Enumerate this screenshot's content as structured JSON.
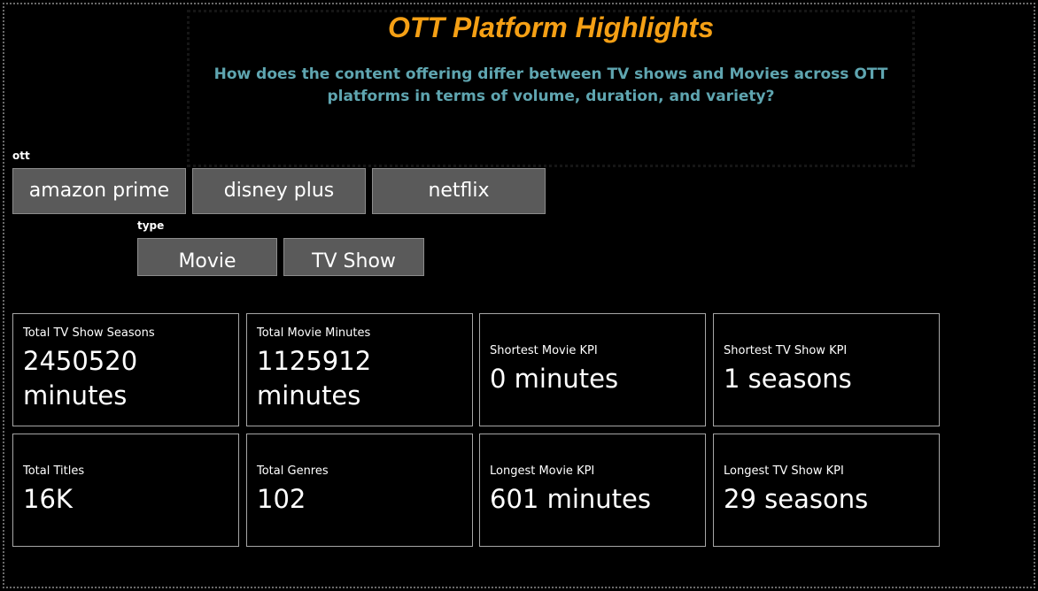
{
  "header": {
    "title": "OTT Platform Highlights",
    "subtitle": "How does the content offering differ between TV shows and Movies across OTT platforms in terms of volume, duration, and variety?"
  },
  "slicers": {
    "ott": {
      "label": "ott",
      "options": [
        "amazon prime",
        "disney plus",
        "netflix"
      ]
    },
    "type": {
      "label": "type",
      "options": [
        "Movie",
        "TV Show"
      ]
    }
  },
  "kpis": [
    {
      "label": "Total TV Show Seasons",
      "value": "2450520 minutes"
    },
    {
      "label": "Total Movie Minutes",
      "value": "1125912 minutes"
    },
    {
      "label": "Shortest Movie KPI",
      "value": "0 minutes"
    },
    {
      "label": "Shortest TV Show KPI",
      "value": "1 seasons"
    },
    {
      "label": "Total Titles",
      "value": "16K"
    },
    {
      "label": "Total Genres",
      "value": "102"
    },
    {
      "label": "Longest Movie KPI",
      "value": "601 minutes"
    },
    {
      "label": "Longest TV Show KPI",
      "value": "29 seasons"
    }
  ],
  "colors": {
    "background": "#000000",
    "title": "#f5a015",
    "subtitle": "#5fa5b0",
    "chip_fill": "#5a5a5a",
    "card_border": "#a6a6a6"
  }
}
